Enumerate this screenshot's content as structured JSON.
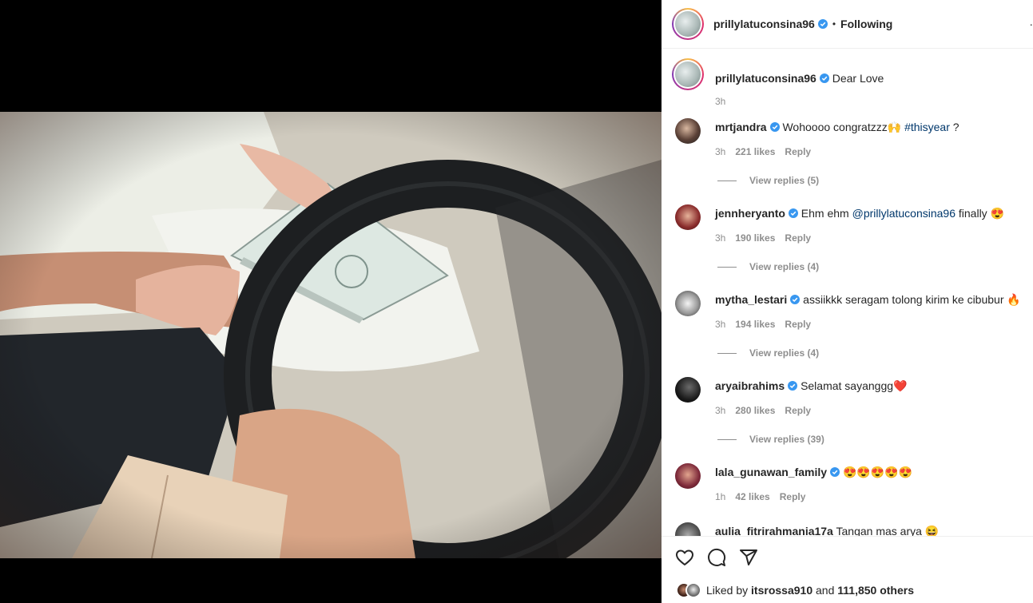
{
  "post": {
    "author": "prillylatuconsina96",
    "follow_status": "Following",
    "separator": "•",
    "more": "·",
    "caption_text": "Dear Love",
    "caption_time": "3h"
  },
  "comments": [
    {
      "user": "mrtjandra",
      "text": "Wohoooo congratzzz🙌 ",
      "tag": "#thisyear",
      "tail": " ?",
      "time": "3h",
      "likes": "221 likes",
      "reply": "Reply",
      "replies": "View replies (5)"
    },
    {
      "user": "jennheryanto",
      "text": "Ehm ehm ",
      "tag": "@prillylatuconsina96",
      "tail": " finally 😍",
      "time": "3h",
      "likes": "190 likes",
      "reply": "Reply",
      "replies": "View replies (4)"
    },
    {
      "user": "mytha_lestari",
      "text": "assiikkk seragam tolong kirim ke cibubur 🔥",
      "tag": "",
      "tail": "",
      "time": "3h",
      "likes": "194 likes",
      "reply": "Reply",
      "replies": "View replies (4)"
    },
    {
      "user": "aryaibrahims",
      "text": "Selamat sayanggg❤️",
      "tag": "",
      "tail": "",
      "time": "3h",
      "likes": "280 likes",
      "reply": "Reply",
      "replies": "View replies (39)"
    },
    {
      "user": "lala_gunawan_family",
      "text": "😍😍😍😍😍",
      "tag": "",
      "tail": "",
      "time": "1h",
      "likes": "42 likes",
      "reply": "Reply",
      "replies": ""
    },
    {
      "user": "aulia_fitrirahmania17a",
      "text": "Tangan mas arya 😆",
      "tag": "",
      "tail": "",
      "time": "",
      "likes": "",
      "reply": "",
      "replies": ""
    }
  ],
  "likes_bar": {
    "prefix": "Liked by",
    "user": "itsrossa910",
    "and": "and",
    "others": "111,850 others"
  },
  "colors": {
    "verified": "#3897f0",
    "link": "#00376b",
    "muted": "#8e8e8e"
  },
  "icons": [
    "heart-icon",
    "comment-icon",
    "share-icon",
    "verified-icon"
  ]
}
